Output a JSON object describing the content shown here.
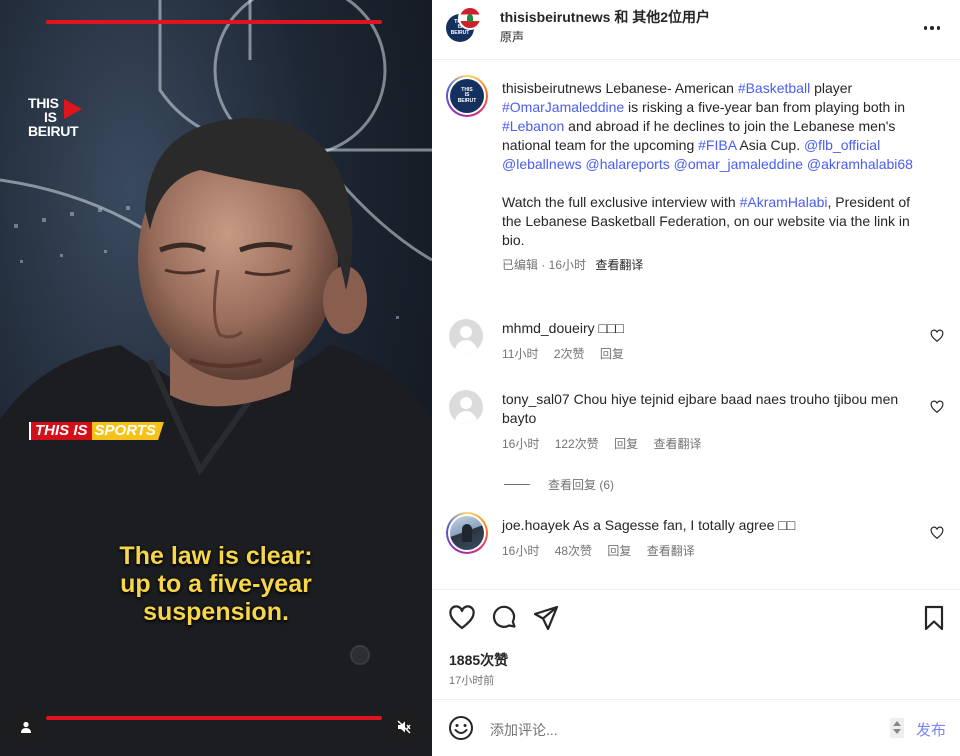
{
  "video": {
    "logo_lines": [
      "THIS",
      "IS",
      "BEIRUT"
    ],
    "tag_a": "THIS IS",
    "tag_b": "SPORTS",
    "caption_lines": [
      "The law is clear:",
      "up to a five-year",
      "suspension."
    ],
    "progress": 1.0
  },
  "header": {
    "username": "thisisbeirutnews",
    "and_others": " 和 其他2位用户",
    "audio": "原声",
    "more_icon": "more-horizontal-icon"
  },
  "post": {
    "username": "thisisbeirutnews",
    "caption_parts": [
      {
        "t": " Lebanese- American ",
        "link": false
      },
      {
        "t": "#Basketball",
        "link": true
      },
      {
        "t": " player ",
        "link": false
      },
      {
        "t": "#OmarJamaleddine",
        "link": true
      },
      {
        "t": " is risking a five-year ban from playing both in ",
        "link": false
      },
      {
        "t": "#Lebanon",
        "link": true
      },
      {
        "t": " and abroad if he declines to join the Lebanese men's national team for the upcoming ",
        "link": false
      },
      {
        "t": "#FIBA",
        "link": true
      },
      {
        "t": " Asia Cup. ",
        "link": false
      },
      {
        "t": "@flb_official",
        "link": true
      },
      {
        "t": " ",
        "link": false
      },
      {
        "t": "@leballnews",
        "link": true
      },
      {
        "t": " ",
        "link": false
      },
      {
        "t": "@halareports",
        "link": true
      },
      {
        "t": " ",
        "link": false
      },
      {
        "t": "@omar_jamaleddine",
        "link": true
      },
      {
        "t": " ",
        "link": false
      },
      {
        "t": "@akramhalabi68",
        "link": true
      }
    ],
    "paragraph2_parts": [
      {
        "t": "Watch the full exclusive interview with ",
        "link": false
      },
      {
        "t": "#AkramHalabi",
        "link": true
      },
      {
        "t": ", President of the Lebanese Basketball Federation, on our website via the link in bio.",
        "link": false
      }
    ],
    "meta": "已编辑 · 16小时",
    "translate": "查看翻译"
  },
  "comments": [
    {
      "user": "mhmd_doueiry",
      "text": " □□□",
      "time": "11小时",
      "likes": "2次赞",
      "reply": "回复",
      "translate": ""
    },
    {
      "user": "tony_sal07",
      "text": " Chou hiye tejnid ejbare baad naes trouho tjibou men bayto",
      "time": "16小时",
      "likes": "122次赞",
      "reply": "回复",
      "translate": "查看翻译"
    },
    {
      "user": "joe.hoayek",
      "text": " As a Sagesse fan, I totally agree □□",
      "time": "16小时",
      "likes": "48次赞",
      "reply": "回复",
      "translate": "查看翻译"
    }
  ],
  "view_replies": "查看回复 (6)",
  "actions": {
    "likes": "1885次赞",
    "time_ago": "17小时前",
    "icons": [
      "heart-icon",
      "comment-icon",
      "share-icon",
      "bookmark-icon"
    ]
  },
  "composer": {
    "placeholder": "添加评论...",
    "post_label": "发布"
  },
  "colors": {
    "link": "#4a5df2",
    "brand_red": "#e0141e",
    "caption_yellow": "#f7d64a"
  }
}
